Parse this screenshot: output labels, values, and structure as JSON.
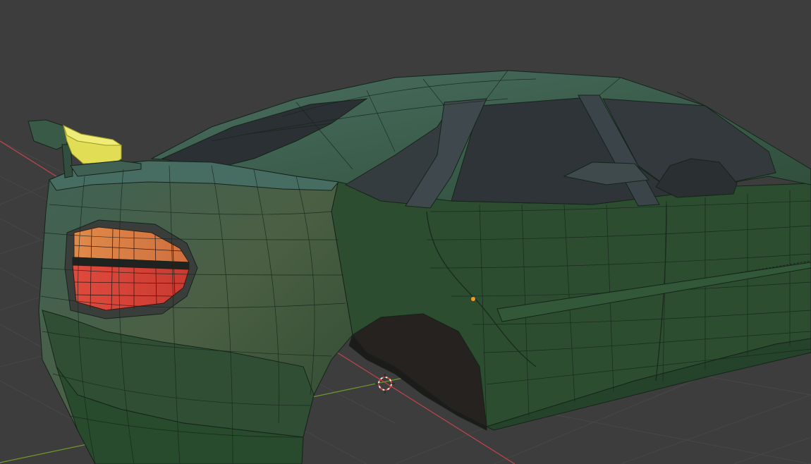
{
  "app": {
    "name": "",
    "view": "3D Viewport"
  },
  "viewport": {
    "background_color": "#3d3d3d",
    "grid_line_color": "#4a4a4a",
    "axis_x_color": "#c2454b",
    "axis_y_color": "#6e9b2a"
  },
  "scene": {
    "object": {
      "kind": "car body mesh",
      "body_color": "#2d4f32",
      "wireframe_color": "#15241a",
      "taillight_upper_color": "#dc7e46",
      "taillight_lower_color": "#d53e34",
      "spoiler_selected_color": "#e1de55",
      "wheel_arch_color": "#23201d",
      "window_frame_color": "#3b4448"
    },
    "origin_dot_color": "#f59a23",
    "cursor_3d": {
      "icon": "3d-cursor-icon",
      "ring_colors": [
        "#e8e8e8",
        "#d9403a"
      ]
    }
  }
}
